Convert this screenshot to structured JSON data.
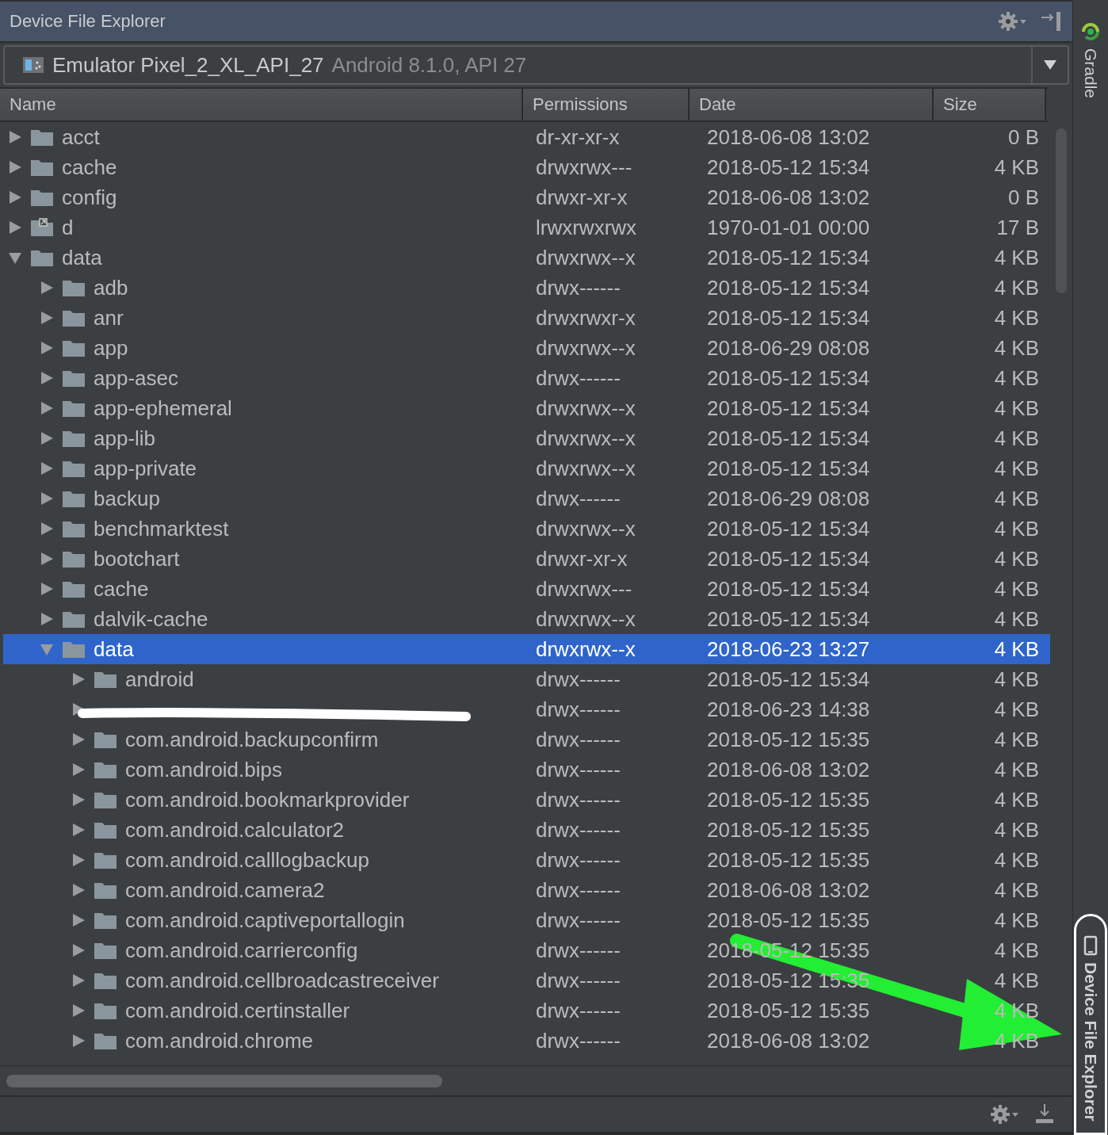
{
  "window": {
    "title": "Device File Explorer"
  },
  "device": {
    "name": "Emulator Pixel_2_XL_API_27",
    "detail": "Android 8.1.0, API 27"
  },
  "columns": [
    "Name",
    "Permissions",
    "Date",
    "Size"
  ],
  "tree": [
    {
      "name": "acct",
      "kind": "folder",
      "expanded": false,
      "selected": false,
      "permissions": "dr-xr-xr-x",
      "date": "2018-06-08 13:02",
      "size": "0 B"
    },
    {
      "name": "cache",
      "kind": "folder",
      "expanded": false,
      "selected": false,
      "permissions": "drwxrwx---",
      "date": "2018-05-12 15:34",
      "size": "4 KB"
    },
    {
      "name": "config",
      "kind": "folder",
      "expanded": false,
      "selected": false,
      "permissions": "drwxr-xr-x",
      "date": "2018-06-08 13:02",
      "size": "0 B"
    },
    {
      "name": "d",
      "kind": "link",
      "expanded": false,
      "selected": false,
      "permissions": "lrwxrwxrwx",
      "date": "1970-01-01 00:00",
      "size": "17 B"
    },
    {
      "name": "data",
      "kind": "folder",
      "expanded": true,
      "selected": false,
      "permissions": "drwxrwx--x",
      "date": "2018-05-12 15:34",
      "size": "4 KB",
      "children": [
        {
          "name": "adb",
          "kind": "folder",
          "expanded": false,
          "selected": false,
          "permissions": "drwx------",
          "date": "2018-05-12 15:34",
          "size": "4 KB"
        },
        {
          "name": "anr",
          "kind": "folder",
          "expanded": false,
          "selected": false,
          "permissions": "drwxrwxr-x",
          "date": "2018-05-12 15:34",
          "size": "4 KB"
        },
        {
          "name": "app",
          "kind": "folder",
          "expanded": false,
          "selected": false,
          "permissions": "drwxrwx--x",
          "date": "2018-06-29 08:08",
          "size": "4 KB"
        },
        {
          "name": "app-asec",
          "kind": "folder",
          "expanded": false,
          "selected": false,
          "permissions": "drwx------",
          "date": "2018-05-12 15:34",
          "size": "4 KB"
        },
        {
          "name": "app-ephemeral",
          "kind": "folder",
          "expanded": false,
          "selected": false,
          "permissions": "drwxrwx--x",
          "date": "2018-05-12 15:34",
          "size": "4 KB"
        },
        {
          "name": "app-lib",
          "kind": "folder",
          "expanded": false,
          "selected": false,
          "permissions": "drwxrwx--x",
          "date": "2018-05-12 15:34",
          "size": "4 KB"
        },
        {
          "name": "app-private",
          "kind": "folder",
          "expanded": false,
          "selected": false,
          "permissions": "drwxrwx--x",
          "date": "2018-05-12 15:34",
          "size": "4 KB"
        },
        {
          "name": "backup",
          "kind": "folder",
          "expanded": false,
          "selected": false,
          "permissions": "drwx------",
          "date": "2018-06-29 08:08",
          "size": "4 KB"
        },
        {
          "name": "benchmarktest",
          "kind": "folder",
          "expanded": false,
          "selected": false,
          "permissions": "drwxrwx--x",
          "date": "2018-05-12 15:34",
          "size": "4 KB"
        },
        {
          "name": "bootchart",
          "kind": "folder",
          "expanded": false,
          "selected": false,
          "permissions": "drwxr-xr-x",
          "date": "2018-05-12 15:34",
          "size": "4 KB"
        },
        {
          "name": "cache",
          "kind": "folder",
          "expanded": false,
          "selected": false,
          "permissions": "drwxrwx---",
          "date": "2018-05-12 15:34",
          "size": "4 KB"
        },
        {
          "name": "dalvik-cache",
          "kind": "folder",
          "expanded": false,
          "selected": false,
          "permissions": "drwxrwx--x",
          "date": "2018-05-12 15:34",
          "size": "4 KB"
        },
        {
          "name": "data",
          "kind": "folder",
          "expanded": true,
          "selected": true,
          "permissions": "drwxrwx--x",
          "date": "2018-06-23 13:27",
          "size": "4 KB",
          "children": [
            {
              "name": "android",
              "kind": "folder",
              "expanded": false,
              "selected": false,
              "permissions": "drwx------",
              "date": "2018-05-12 15:34",
              "size": "4 KB"
            },
            {
              "kind": "redacted",
              "expanded": false,
              "selected": false,
              "permissions": "drwx------",
              "date": "2018-06-23 14:38",
              "size": "4 KB"
            },
            {
              "name": "com.android.backupconfirm",
              "kind": "folder",
              "expanded": false,
              "selected": false,
              "permissions": "drwx------",
              "date": "2018-05-12 15:35",
              "size": "4 KB"
            },
            {
              "name": "com.android.bips",
              "kind": "folder",
              "expanded": false,
              "selected": false,
              "permissions": "drwx------",
              "date": "2018-06-08 13:02",
              "size": "4 KB"
            },
            {
              "name": "com.android.bookmarkprovider",
              "kind": "folder",
              "expanded": false,
              "selected": false,
              "permissions": "drwx------",
              "date": "2018-05-12 15:35",
              "size": "4 KB"
            },
            {
              "name": "com.android.calculator2",
              "kind": "folder",
              "expanded": false,
              "selected": false,
              "permissions": "drwx------",
              "date": "2018-05-12 15:35",
              "size": "4 KB"
            },
            {
              "name": "com.android.calllogbackup",
              "kind": "folder",
              "expanded": false,
              "selected": false,
              "permissions": "drwx------",
              "date": "2018-05-12 15:35",
              "size": "4 KB"
            },
            {
              "name": "com.android.camera2",
              "kind": "folder",
              "expanded": false,
              "selected": false,
              "permissions": "drwx------",
              "date": "2018-06-08 13:02",
              "size": "4 KB"
            },
            {
              "name": "com.android.captiveportallogin",
              "kind": "folder",
              "expanded": false,
              "selected": false,
              "permissions": "drwx------",
              "date": "2018-05-12 15:35",
              "size": "4 KB"
            },
            {
              "name": "com.android.carrierconfig",
              "kind": "folder",
              "expanded": false,
              "selected": false,
              "permissions": "drwx------",
              "date": "2018-05-12 15:35",
              "size": "4 KB"
            },
            {
              "name": "com.android.cellbroadcastreceiver",
              "kind": "folder",
              "expanded": false,
              "selected": false,
              "permissions": "drwx------",
              "date": "2018-05-12 15:35",
              "size": "4 KB"
            },
            {
              "name": "com.android.certinstaller",
              "kind": "folder",
              "expanded": false,
              "selected": false,
              "permissions": "drwx------",
              "date": "2018-05-12 15:35",
              "size": "4 KB"
            },
            {
              "name": "com.android.chrome",
              "kind": "folder",
              "expanded": false,
              "selected": false,
              "permissions": "drwx------",
              "date": "2018-06-08 13:02",
              "size": "4 KB"
            }
          ]
        }
      ]
    }
  ],
  "side_tabs": [
    {
      "label": "Gradle",
      "kind": "gradle",
      "selected": false
    },
    {
      "label": "Device File Explorer",
      "kind": "device",
      "selected": true
    }
  ]
}
